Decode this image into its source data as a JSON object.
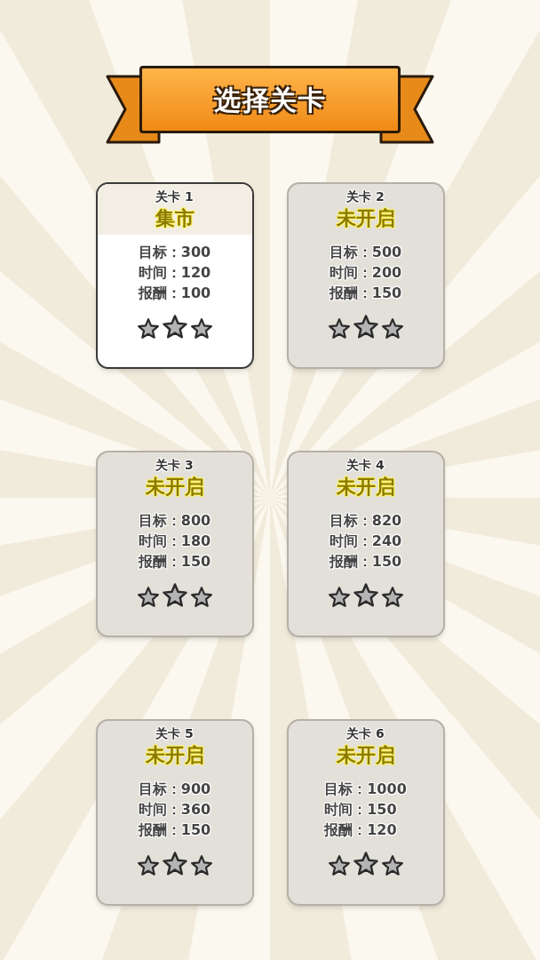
{
  "title": "选择关卡",
  "levels": [
    {
      "label": "关卡 1",
      "name": "集市",
      "locked": false,
      "stats": [
        "目标：300",
        "时间：120",
        "报酬：100"
      ],
      "stars": 0
    },
    {
      "label": "关卡 2",
      "name": "未开启",
      "locked": true,
      "stats": [
        "目标：500",
        "时间：200",
        "报酬：150"
      ],
      "stars": 0
    },
    {
      "label": "关卡 3",
      "name": "未开启",
      "locked": true,
      "stats": [
        "目标：800",
        "时间：180",
        "报酬：150"
      ],
      "stars": 0
    },
    {
      "label": "关卡 4",
      "name": "未开启",
      "locked": true,
      "stats": [
        "目标：820",
        "时间：240",
        "报酬：150"
      ],
      "stars": 0
    },
    {
      "label": "关卡 5",
      "name": "未开启",
      "locked": true,
      "stats": [
        "目标：900",
        "时间：360",
        "报酬：150"
      ],
      "stars": 0
    },
    {
      "label": "关卡 6",
      "name": "未开启",
      "locked": true,
      "stats": [
        "目标：1000",
        "时间：150",
        "报酬：120"
      ],
      "stars": 0
    }
  ]
}
